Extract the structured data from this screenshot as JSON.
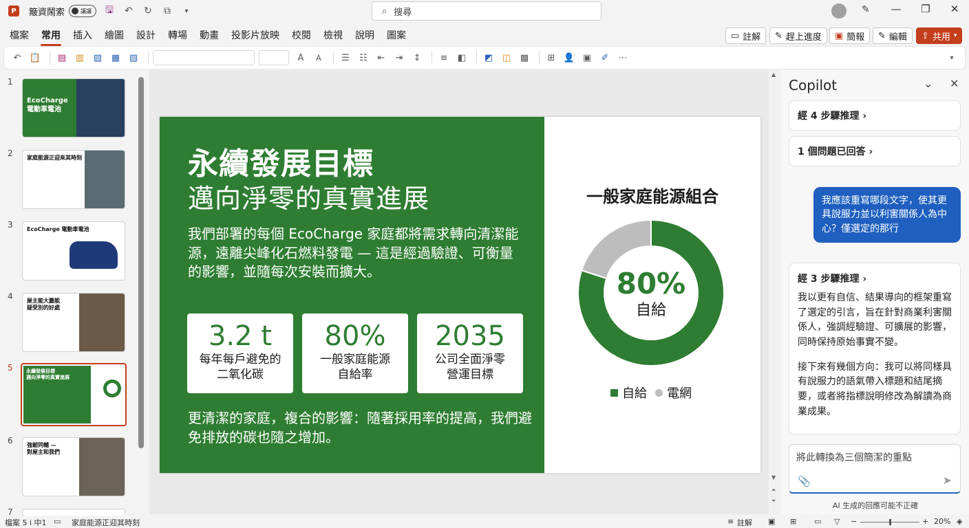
{
  "titlebar": {
    "app_icon": "P",
    "autosave_label": "簸資鬧索",
    "toggle_label": "讓讓",
    "search_placeholder": "搜尋"
  },
  "ribbon": {
    "tabs": [
      "檔案",
      "常用",
      "插入",
      "繪圖",
      "設計",
      "轉場",
      "動畫",
      "投影片放映",
      "校閱",
      "檢視",
      "說明",
      "圖案"
    ],
    "active_tab": "常用",
    "right_buttons": {
      "comments": "註解",
      "catch_up": "趕上進度",
      "present": "簡報",
      "edit": "編輯",
      "share": "共用"
    }
  },
  "thumbnails": [
    {
      "num": "1",
      "title": "EcoCharge\n電動車電池"
    },
    {
      "num": "2",
      "title": "家庭能源正迎來其時刻"
    },
    {
      "num": "3",
      "title": "EcoCharge 電動車電池"
    },
    {
      "num": "4",
      "title": "屋主能大膽能\n疑受別的好處"
    },
    {
      "num": "5",
      "title": "永續發展目標\n邁向淨零的真實進展"
    },
    {
      "num": "6",
      "title": "強韌同輔 —\n對屋主和我們"
    },
    {
      "num": "7",
      "title": ""
    }
  ],
  "slide": {
    "title": "永續發展目標",
    "subtitle": "邁向淨零的真實進展",
    "body": "我們部署的每個 EcoCharge 家庭都將需求轉向清潔能源，遠離尖峰化石燃料發電 — 這是經過驗證、可衡量的影響，並隨每次安裝而擴大。",
    "stats": [
      {
        "value": "3.2 t",
        "label1": "每年每戶避免的",
        "label2": "二氧化碳"
      },
      {
        "value": "80%",
        "label1": "一般家庭能源",
        "label2": "自給率"
      },
      {
        "value": "2035",
        "label1": "公司全面淨零",
        "label2": "營運目標"
      }
    ],
    "footer": "更清潔的家庭，複合的影響：隨著採用率的提高，我們避免排放的碳也隨之增加。",
    "colors": {
      "green": "#2e7d32",
      "grey": "#bdbdbd"
    }
  },
  "chart_data": {
    "type": "pie",
    "title": "一般家庭能源組合",
    "center_value": "80%",
    "center_label": "自給",
    "slices": [
      {
        "name": "自給",
        "value": 80
      },
      {
        "name": "電網",
        "value": 20
      }
    ],
    "legend": "bottom"
  },
  "copilot": {
    "title": "Copilot",
    "reasoning1": "經 4 步驟推理 ›",
    "answered": "1 個問題已回答 ›",
    "user_message": "我應該重寫哪段文字，使其更具說服力並以利害關係人為中心？僅選定的那行",
    "reasoning2": "經 3 步驟推理 ›",
    "response_p1": "我以更有自信、結果導向的框架重寫了選定的引言，旨在針對商業利害關係人，強調經驗證、可擴展的影響，同時保持原始事實不變。",
    "response_p2": "接下來有幾個方向：我可以將同樣具有說服力的語氣帶入標題和結尾摘要，或者將指標說明修改為解讀為商業成果。",
    "input_value": "將此轉換為三個簡潔的重點",
    "disclaimer": "AI 生成的回應可能不正確"
  },
  "statusbar": {
    "slide_info": "檔案 5 i 中1",
    "notes_label": "家庭能源正迎其時刻",
    "comments_label": "註解",
    "zoom": "20%"
  }
}
